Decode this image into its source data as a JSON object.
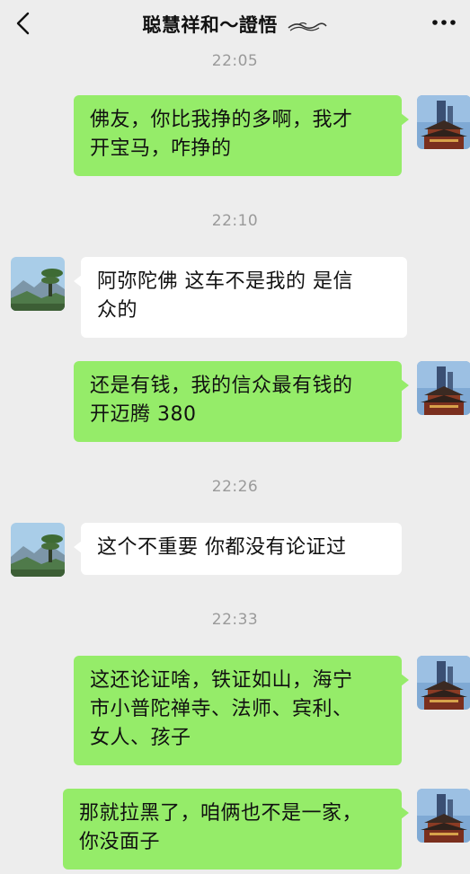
{
  "header": {
    "title": "聪慧祥和～證悟",
    "back_icon": "chevron-left-icon",
    "more_icon": "ellipsis-icon"
  },
  "timestamps": [
    "22:05",
    "22:10",
    "22:26",
    "22:33"
  ],
  "messages": [
    {
      "side": "right",
      "lines": [
        "佛友，你比我挣的多啊，我才",
        "开宝马，咋挣的"
      ]
    },
    {
      "side": "left",
      "lines": [
        "阿弥陀佛  这车不是我的  是信",
        "众的"
      ]
    },
    {
      "side": "right",
      "lines": [
        "还是有钱，我的信众最有钱的",
        "开迈腾 380"
      ]
    },
    {
      "side": "left",
      "lines": [
        "这个不重要   你都没有论证过"
      ]
    },
    {
      "side": "right",
      "lines": [
        "这还论证啥，铁证如山，海宁",
        "市小普陀禅寺、法师、宾利、",
        "女人、孩子"
      ]
    },
    {
      "side": "right",
      "lines": [
        "那就拉黑了，咱俩也不是一家，",
        "你没面子"
      ]
    }
  ]
}
